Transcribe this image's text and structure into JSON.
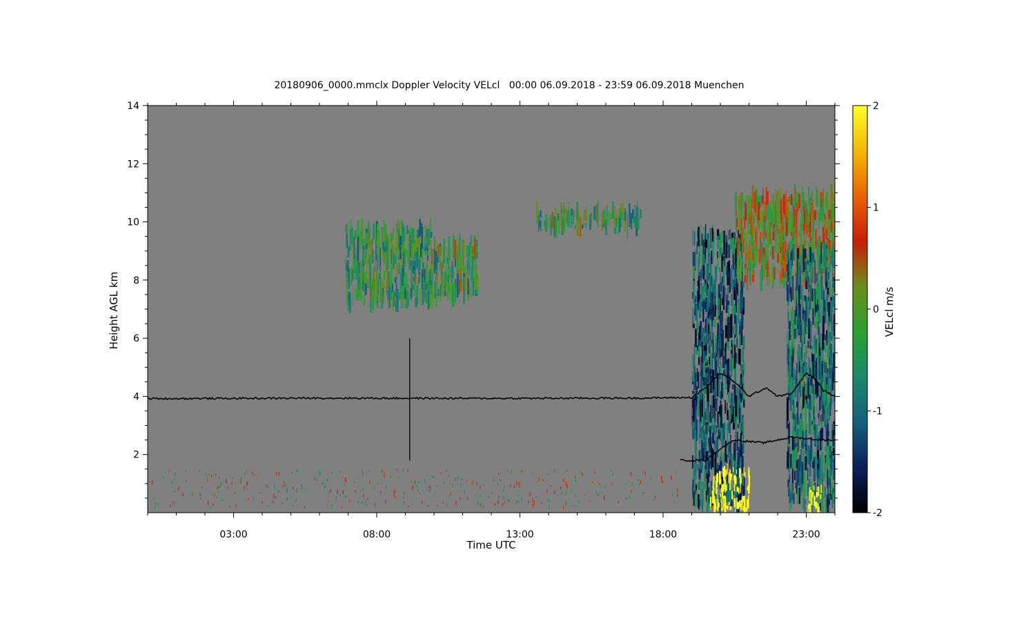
{
  "chart_data": {
    "type": "heatmap",
    "title": "20180906_0000.mmclx Doppler Velocity VELcl   00:00 06.09.2018 - 23:59 06.09.2018 Muenchen",
    "xlabel": "Time UTC",
    "ylabel": "Height AGL km",
    "colorbar_label": "VELcl m/s",
    "x_unit": "hours UTC",
    "xlim": [
      0.0,
      24.0
    ],
    "ylim": [
      0.0,
      14.0
    ],
    "x_ticks": [
      {
        "value": 3,
        "label": "03:00"
      },
      {
        "value": 8,
        "label": "08:00"
      },
      {
        "value": 13,
        "label": "13:00"
      },
      {
        "value": 18,
        "label": "18:00"
      },
      {
        "value": 23,
        "label": "23:00"
      }
    ],
    "y_ticks": [
      {
        "value": 2,
        "label": "2"
      },
      {
        "value": 4,
        "label": "4"
      },
      {
        "value": 6,
        "label": "6"
      },
      {
        "value": 8,
        "label": "8"
      },
      {
        "value": 10,
        "label": "10"
      },
      {
        "value": 12,
        "label": "12"
      },
      {
        "value": 14,
        "label": "14"
      }
    ],
    "colorbar": {
      "range": [
        -2,
        2
      ],
      "ticks": [
        {
          "value": 2,
          "label": "2"
        },
        {
          "value": 1,
          "label": "1"
        },
        {
          "value": 0,
          "label": "0"
        },
        {
          "value": -1,
          "label": "-1"
        },
        {
          "value": -2,
          "label": "-2"
        }
      ],
      "colors": [
        "#000000",
        "#0b1f5c",
        "#14607a",
        "#1a8a6a",
        "#2aa030",
        "#6a8f1a",
        "#c81e0a",
        "#e86400",
        "#f4b800",
        "#ffff2a"
      ]
    },
    "background_color": "#808080",
    "grid": false,
    "regions": [
      {
        "name": "cirrus-morning",
        "t": [
          6.9,
          9.9
        ],
        "h": [
          7.2,
          9.8
        ],
        "velocity": -0.4
      },
      {
        "name": "cirrus-fragments",
        "t": [
          9.9,
          11.5
        ],
        "h": [
          7.4,
          9.2
        ],
        "velocity": -0.3
      },
      {
        "name": "cirrus-midday",
        "t": [
          13.5,
          17.2
        ],
        "h": [
          9.8,
          10.4
        ],
        "velocity": -0.35
      },
      {
        "name": "convective-cell-1",
        "t": [
          19.0,
          20.8
        ],
        "h": [
          0.2,
          9.6
        ],
        "velocity": -1.2
      },
      {
        "name": "anvil-upper",
        "t": [
          20.5,
          24.0
        ],
        "h": [
          8.0,
          10.9
        ],
        "velocity": 0.2
      },
      {
        "name": "convective-cell-2",
        "t": [
          22.3,
          24.0
        ],
        "h": [
          0.2,
          9.0
        ],
        "velocity": -1.0
      },
      {
        "name": "precip-core-1",
        "t": [
          19.6,
          21.0
        ],
        "h": [
          0.1,
          1.5
        ],
        "velocity": 2.0
      },
      {
        "name": "precip-core-2",
        "t": [
          23.0,
          23.6
        ],
        "h": [
          0.1,
          0.9
        ],
        "velocity": 2.0
      }
    ],
    "lines": [
      {
        "name": "reference-line",
        "points": [
          [
            0.0,
            3.92
          ],
          [
            6.0,
            3.94
          ],
          [
            12.0,
            3.93
          ],
          [
            17.0,
            3.94
          ],
          [
            19.0,
            3.96
          ],
          [
            19.5,
            4.3
          ],
          [
            20.0,
            4.8
          ],
          [
            20.5,
            4.5
          ],
          [
            21.0,
            4.0
          ],
          [
            21.6,
            4.3
          ],
          [
            22.0,
            4.0
          ],
          [
            22.5,
            4.1
          ],
          [
            23.0,
            4.8
          ],
          [
            23.3,
            4.6
          ],
          [
            23.6,
            4.2
          ],
          [
            24.0,
            4.0
          ]
        ]
      },
      {
        "name": "lower-line",
        "points": [
          [
            18.6,
            1.8
          ],
          [
            19.5,
            1.8
          ],
          [
            20.0,
            2.2
          ],
          [
            20.5,
            2.5
          ],
          [
            21.5,
            2.4
          ],
          [
            22.5,
            2.6
          ],
          [
            23.5,
            2.5
          ],
          [
            24.0,
            2.5
          ]
        ]
      }
    ],
    "spike": {
      "t": 9.15,
      "h": [
        1.8,
        6.0
      ]
    }
  }
}
